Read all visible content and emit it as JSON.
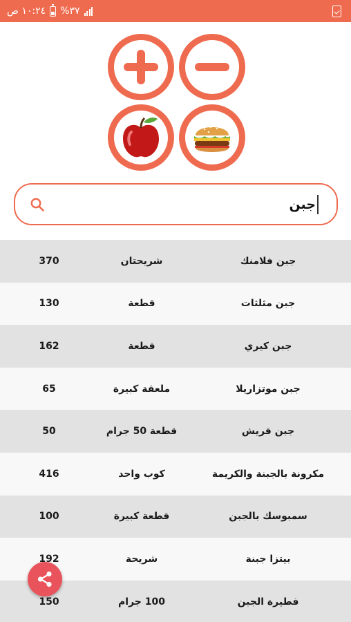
{
  "status_bar": {
    "time": "١٠:٢٤ ص",
    "battery": "%٣٧",
    "signal": "ıl",
    "bg_color": "#ef6b4f"
  },
  "actions": {
    "add_icon": "plus-icon",
    "remove_icon": "minus-icon",
    "fruit_icon": "apple-icon",
    "fastfood_icon": "burger-icon",
    "accent_color": "#ef6b4f"
  },
  "search": {
    "value": "جبن",
    "icon": "search-icon"
  },
  "food_list": [
    {
      "name": "جبن فلامنك",
      "unit": "شريحتان",
      "calories": "370"
    },
    {
      "name": "جبن مثلثات",
      "unit": "قطعة",
      "calories": "130"
    },
    {
      "name": "جبن كيري",
      "unit": "قطعة",
      "calories": "162"
    },
    {
      "name": "جبن موتزاريلا",
      "unit": "ملعقة كبيرة",
      "calories": "65"
    },
    {
      "name": "جبن قريش",
      "unit": "قطعة 50 جرام",
      "calories": "50"
    },
    {
      "name": "مكرونة بالجبنة والكريمة",
      "unit": "كوب واحد",
      "calories": "416"
    },
    {
      "name": "سمبوسك بالجبن",
      "unit": "قطعة كبيرة",
      "calories": "100"
    },
    {
      "name": "بيتزا جبنة",
      "unit": "شريحة",
      "calories": "192"
    },
    {
      "name": "فطيرة الجبن",
      "unit": "100 جرام",
      "calories": "150"
    }
  ],
  "share": {
    "icon": "share-icon",
    "color": "#e9545c"
  }
}
